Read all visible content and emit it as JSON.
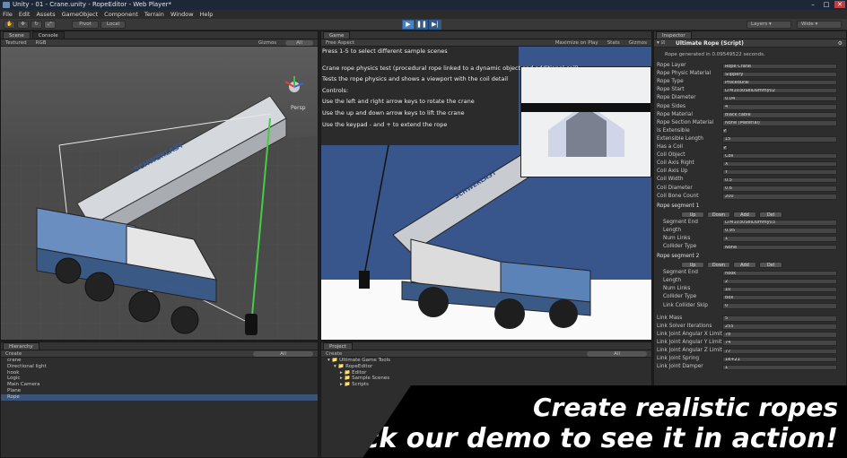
{
  "window": {
    "title": "Unity - 01 - Crane.unity - RopeEditor - Web Player*"
  },
  "menu": [
    "File",
    "Edit",
    "Assets",
    "GameObject",
    "Component",
    "Terrain",
    "Window",
    "Help"
  ],
  "toolbar": {
    "pivot": "Pivot",
    "local": "Local",
    "layers": "Layers",
    "layout": "Wide"
  },
  "scene": {
    "tab_scene": "Scene",
    "tab_console": "Console",
    "mode": "Textured",
    "color": "RGB",
    "gizmos": "Gizmos",
    "search": "All",
    "persp": "Persp",
    "truck_text": "SCHWERLAST"
  },
  "game": {
    "tab": "Game",
    "aspect": "Free Aspect",
    "maximize": "Maximize on Play",
    "stats": "Stats",
    "gizmos": "Gizmos",
    "instructions": [
      "Press 1-5 to select different sample scenes",
      "Crane rope physics test (procedural rope linked to a dynamic object and additional coil)",
      "Tests the rope physics and shows a viewport with the coil detail",
      "Controls:",
      "Use the left and right arrow keys to rotate the crane",
      "Use the up and down arrow keys to lift the crane",
      "Use the keypad - and + to extend the rope"
    ],
    "truck_text": "SCHWERLAST"
  },
  "hierarchy": {
    "tab": "Hierarchy",
    "create": "Create",
    "search": "All",
    "items": [
      "crane",
      "Directional light",
      "hook",
      "Logic",
      "Main Camera",
      "Plane",
      "Rope"
    ],
    "selected_index": 6
  },
  "project": {
    "tab": "Project",
    "create": "Create",
    "search": "All",
    "items": [
      "Ultimate Game Tools",
      "RopeEditor",
      "Editor",
      "Sample Scenes",
      "Scripts"
    ]
  },
  "inspector": {
    "tab": "Inspector",
    "component": "Ultimate Rope (Script)",
    "status": "Rope generated in 0.09549522 seconds.",
    "props": [
      {
        "label": "Rope Layer",
        "value": "Rope Crane"
      },
      {
        "label": "Rope Physic Material",
        "value": "Slippery"
      },
      {
        "label": "Rope Type",
        "value": "Procedural"
      },
      {
        "label": "Rope Start",
        "value": "LTM1030SelDummy02"
      },
      {
        "label": "Rope Diameter",
        "value": "0.04"
      },
      {
        "label": "Rope Sides",
        "value": "4"
      },
      {
        "label": "Rope Material",
        "value": "Black cable"
      },
      {
        "label": "Rope Section Material",
        "value": "None (Material)"
      },
      {
        "label": "Is Extensible",
        "check": "✓"
      },
      {
        "label": "Extensible Length",
        "value": "15"
      },
      {
        "label": "Has a Coil",
        "check": "✓"
      },
      {
        "label": "Coil Object",
        "value": "Coil"
      },
      {
        "label": "Coil Axis Right",
        "value": "X"
      },
      {
        "label": "Coil Axis Up",
        "value": "Y"
      },
      {
        "label": "Coil Width",
        "value": "0.5"
      },
      {
        "label": "Coil Diameter",
        "value": "0.6"
      },
      {
        "label": "Coil Bone Count",
        "value": "200"
      }
    ],
    "segment1": {
      "title": "Rope segment 1",
      "buttons": [
        "Up",
        "Down",
        "Add",
        "Del"
      ],
      "props": [
        {
          "label": "Segment End",
          "value": "LTM1030SelDummy03"
        },
        {
          "label": "Length",
          "value": "0.95"
        },
        {
          "label": "Num Links",
          "value": "1"
        },
        {
          "label": "Collider Type",
          "value": "None"
        }
      ]
    },
    "segment2": {
      "title": "Rope segment 2",
      "buttons": [
        "Up",
        "Down",
        "Add",
        "Del"
      ],
      "props": [
        {
          "label": "Segment End",
          "value": "hook"
        },
        {
          "label": "Length",
          "value": "2"
        },
        {
          "label": "Num Links",
          "value": "10"
        },
        {
          "label": "Collider Type",
          "value": "Box"
        },
        {
          "label": "Link Collider Skip",
          "value": "0"
        }
      ]
    },
    "props2": [
      {
        "label": "Link Mass",
        "value": "5"
      },
      {
        "label": "Link Solver Iterations",
        "value": "255"
      },
      {
        "label": "Link Joint Angular X Limit",
        "value": "78"
      },
      {
        "label": "Link Joint Angular Y Limit",
        "value": "74"
      },
      {
        "label": "Link Joint Angular Z Limit",
        "value": "77"
      },
      {
        "label": "Link Joint Spring",
        "value": "1e+21"
      },
      {
        "label": "Link Joint Damper",
        "value": "1"
      }
    ]
  },
  "banner": {
    "line1": "Create realistic ropes",
    "line2": "Check our demo to see it in action!"
  }
}
